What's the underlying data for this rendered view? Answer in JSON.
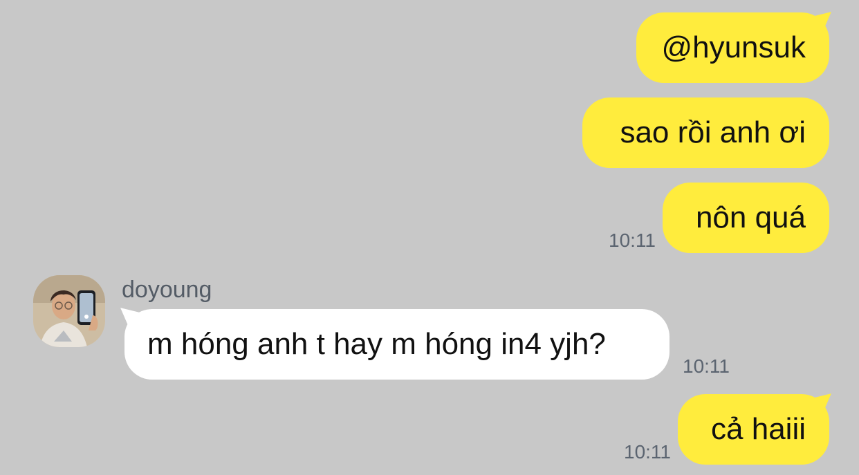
{
  "conversation": {
    "messages": [
      {
        "direction": "outgoing",
        "text": "@hyunsuk"
      },
      {
        "direction": "outgoing",
        "text": "sao rồi anh ơi"
      },
      {
        "direction": "outgoing",
        "text": "nôn quá",
        "time": "10:11"
      },
      {
        "direction": "incoming",
        "sender": "doyoung",
        "text": "m hóng anh t hay m hóng in4 yjh?",
        "time": "10:11"
      },
      {
        "direction": "outgoing",
        "text": "cả haiii",
        "time": "10:11"
      }
    ]
  },
  "colors": {
    "background": "#c8c8c8",
    "outgoing_bubble": "#ffec3d",
    "incoming_bubble": "#ffffff",
    "timestamp": "#5b6470",
    "sender_name": "#545c66"
  },
  "icons": {
    "avatar": "doyoung-avatar-photo"
  }
}
